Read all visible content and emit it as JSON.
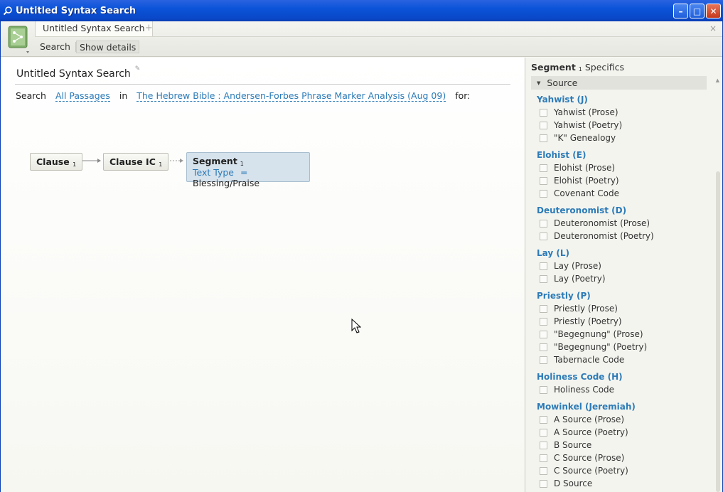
{
  "window": {
    "title": "Untitled Syntax Search",
    "buttons": {
      "minimize": "–",
      "maximize": "□",
      "close": "✕"
    }
  },
  "tabs": {
    "active_label": "Untitled Syntax Search",
    "add_label": "+",
    "close_label": "×"
  },
  "toolbar": {
    "search_label": "Search",
    "details_label": "Show details"
  },
  "main": {
    "title": "Untitled Syntax Search",
    "search_prefix": "Search",
    "passages": "All Passages",
    "in_word": "in",
    "resource": "The Hebrew Bible : Andersen-Forbes Phrase Marker Analysis (Aug 09)",
    "for_word": "for:",
    "nodes": {
      "clause": {
        "label": "Clause",
        "index": "1"
      },
      "clause_ic": {
        "label": "Clause IC",
        "index": "1"
      },
      "segment": {
        "label": "Segment",
        "index": "1",
        "field": "Text Type",
        "operator": "=",
        "value": "Blessing/Praise"
      }
    }
  },
  "side": {
    "heading_bold": "Segment",
    "heading_index": "1",
    "heading_rest": "Specifics",
    "section_label": "Source",
    "groups": [
      {
        "title": "Yahwist (J)",
        "options": [
          "Yahwist (Prose)",
          "Yahwist (Poetry)",
          "\"K\" Genealogy"
        ]
      },
      {
        "title": "Elohist (E)",
        "options": [
          "Elohist (Prose)",
          "Elohist (Poetry)",
          "Covenant Code"
        ]
      },
      {
        "title": "Deuteronomist (D)",
        "options": [
          "Deuteronomist (Prose)",
          "Deuteronomist (Poetry)"
        ]
      },
      {
        "title": "Lay (L)",
        "options": [
          "Lay (Prose)",
          "Lay (Poetry)"
        ]
      },
      {
        "title": "Priestly (P)",
        "options": [
          "Priestly (Prose)",
          "Priestly (Poetry)",
          "\"Begegnung\" (Prose)",
          "\"Begegnung\" (Poetry)",
          "Tabernacle Code"
        ]
      },
      {
        "title": "Holiness Code (H)",
        "options": [
          "Holiness Code"
        ]
      },
      {
        "title": "Mowinkel (Jeremiah)",
        "options": [
          "A Source (Prose)",
          "A Source (Poetry)",
          "B Source",
          "C Source (Prose)",
          "C Source (Poetry)",
          "D Source"
        ]
      }
    ]
  },
  "colors": {
    "accent": "#2c7bb8",
    "titlebar": "#0a48c8",
    "segment_fill": "#d6e2ec"
  },
  "icons": [
    "search-app-icon",
    "syntax-doc-icon",
    "pencil-icon",
    "collapse-triangle-icon",
    "mouse-cursor-icon"
  ]
}
